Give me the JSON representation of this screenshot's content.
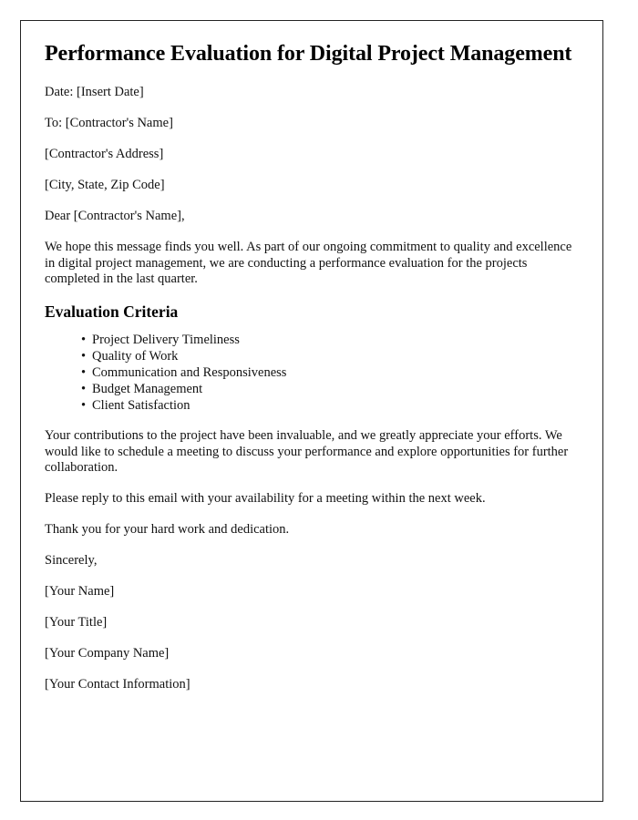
{
  "document": {
    "title": "Performance Evaluation for Digital Project Management",
    "header_lines": [
      "Date: [Insert Date]",
      "To: [Contractor's Name]",
      "[Contractor's Address]",
      "[City, State, Zip Code]"
    ],
    "salutation": "Dear [Contractor's Name],",
    "intro_paragraph": "We hope this message finds you well. As part of our ongoing commitment to quality and excellence in digital project management, we are conducting a performance evaluation for the projects completed in the last quarter.",
    "criteria_heading": "Evaluation Criteria",
    "criteria_items": [
      "Project Delivery Timeliness",
      "Quality of Work",
      "Communication and Responsiveness",
      "Budget Management",
      "Client Satisfaction"
    ],
    "bullet_glyph": "•",
    "appreciation_paragraph": "Your contributions to the project have been invaluable, and we greatly appreciate your efforts. We would like to schedule a meeting to discuss your performance and explore opportunities for further collaboration.",
    "reply_paragraph": "Please reply to this email with your availability for a meeting within the next week.",
    "thanks_paragraph": "Thank you for your hard work and dedication.",
    "closing": "Sincerely,",
    "signature_lines": [
      "[Your Name]",
      "[Your Title]",
      "[Your Company Name]",
      "[Your Contact Information]"
    ]
  },
  "style": {
    "page_background": "#ffffff",
    "border_color": "#232323",
    "text_color": "#111111",
    "title_color": "#000000"
  }
}
